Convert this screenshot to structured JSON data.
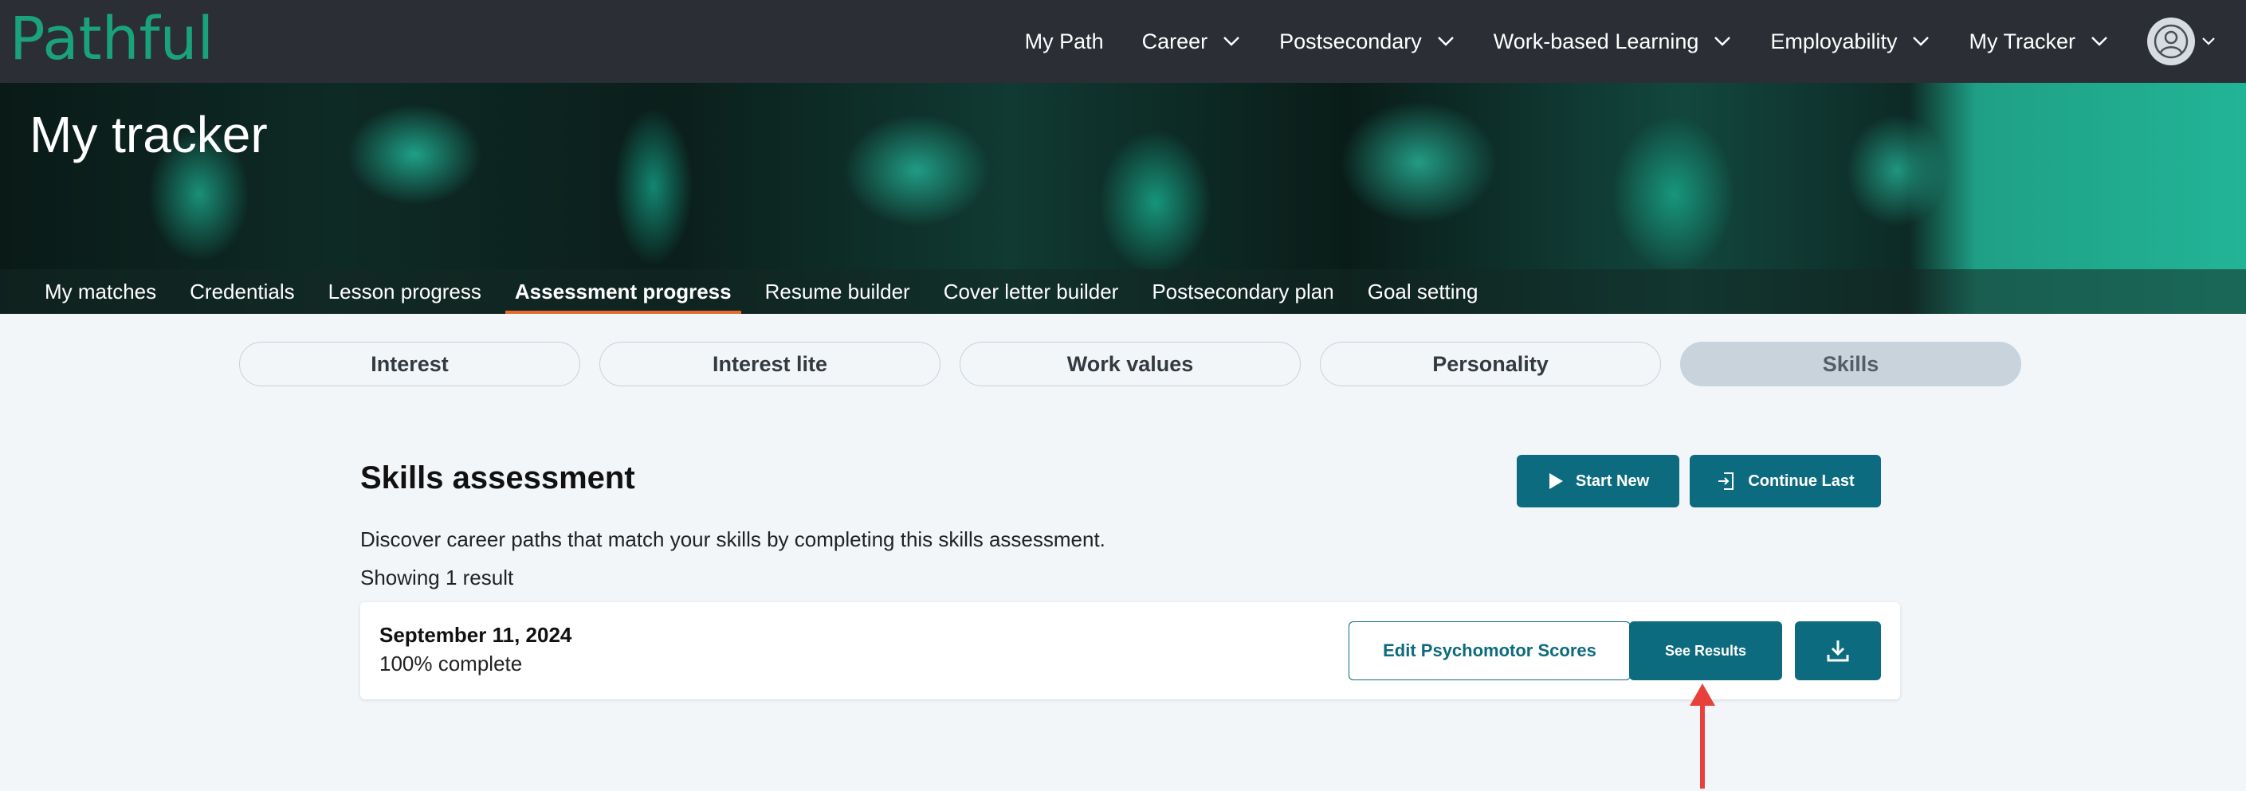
{
  "brand": {
    "logo_text": "Pathful",
    "logo_color": "#1aa37a"
  },
  "topnav": {
    "items": [
      {
        "label": "My Path",
        "has_dropdown": false
      },
      {
        "label": "Career",
        "has_dropdown": true
      },
      {
        "label": "Postsecondary",
        "has_dropdown": true
      },
      {
        "label": "Work-based Learning",
        "has_dropdown": true
      },
      {
        "label": "Employability",
        "has_dropdown": true
      },
      {
        "label": "My Tracker",
        "has_dropdown": true
      }
    ],
    "avatar_icon": "user-circle-icon"
  },
  "hero": {
    "title": "My tracker",
    "tabs": [
      {
        "label": "My matches",
        "active": false
      },
      {
        "label": "Credentials",
        "active": false
      },
      {
        "label": "Lesson progress",
        "active": false
      },
      {
        "label": "Assessment progress",
        "active": true
      },
      {
        "label": "Resume builder",
        "active": false
      },
      {
        "label": "Cover letter builder",
        "active": false
      },
      {
        "label": "Postsecondary plan",
        "active": false
      },
      {
        "label": "Goal setting",
        "active": false
      }
    ],
    "active_tab_color": "#e36b2c"
  },
  "subtabs": [
    {
      "label": "Interest",
      "active": false
    },
    {
      "label": "Interest lite",
      "active": false
    },
    {
      "label": "Work values",
      "active": false
    },
    {
      "label": "Personality",
      "active": false
    },
    {
      "label": "Skills",
      "active": true
    }
  ],
  "assessment": {
    "title": "Skills assessment",
    "start_new_label": "Start New",
    "continue_last_label": "Continue Last",
    "description": "Discover career paths that match your skills by completing this skills assessment.",
    "showing": "Showing 1 result",
    "results": [
      {
        "date": "September 11, 2024",
        "status": "100% complete",
        "edit_label": "Edit Psychomotor Scores",
        "see_results_label": "See Results",
        "download_icon": "download-icon"
      }
    ]
  },
  "colors": {
    "primary": "#0c6b7e",
    "nav_bg": "#2b2f35",
    "annotation": "#e8413c"
  }
}
